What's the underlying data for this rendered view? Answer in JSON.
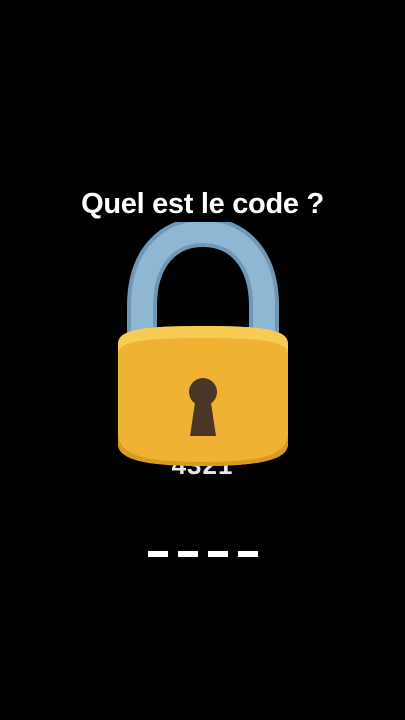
{
  "screen": {
    "title": "Quel est le code ?",
    "hint_code": "4321",
    "code_slots": [
      "_",
      "_",
      "_",
      "_"
    ]
  },
  "colors": {
    "background": "#000000",
    "text": "#ffffff",
    "lock_body": "#f1b733",
    "lock_shackle": "#7fa8c5",
    "keyhole": "#4a3626"
  },
  "icons": {
    "lock": "padlock-icon"
  }
}
